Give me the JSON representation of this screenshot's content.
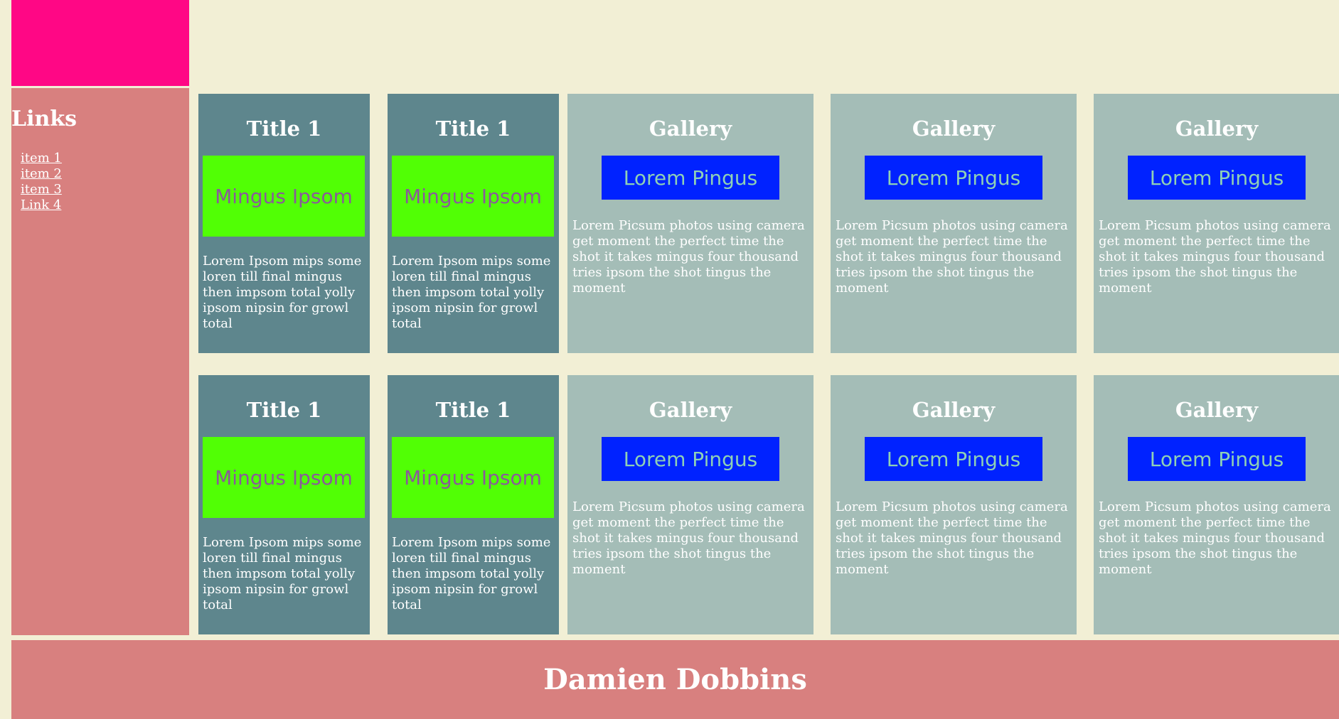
{
  "sidebar": {
    "heading": "Links",
    "items": [
      {
        "label": "item 1"
      },
      {
        "label": "item 2"
      },
      {
        "label": "item 3"
      },
      {
        "label": "Link 4"
      }
    ]
  },
  "title_card": {
    "heading": "Title 1",
    "image_label": "Mingus Ipsom",
    "text": "Lorem Ipsom mips some loren till final mingus then impsom total yolly ipsom nipsin for growl total"
  },
  "gallery_card": {
    "heading": "Gallery",
    "image_label": "Lorem Pingus",
    "text": "Lorem Picsum photos using camera get moment the perfect time the shot it takes mingus four thousand tries ipsom the shot tingus the moment"
  },
  "footer": {
    "name": "Damien Dobbins"
  },
  "colors": {
    "background": "#f2efd5",
    "logo": "#ff0785",
    "sidebar": "#d8807f",
    "title_card": "#5e868d",
    "gallery_card": "#a4bdb7",
    "green_box": "#51ff05",
    "blue_box": "#0022ff"
  }
}
